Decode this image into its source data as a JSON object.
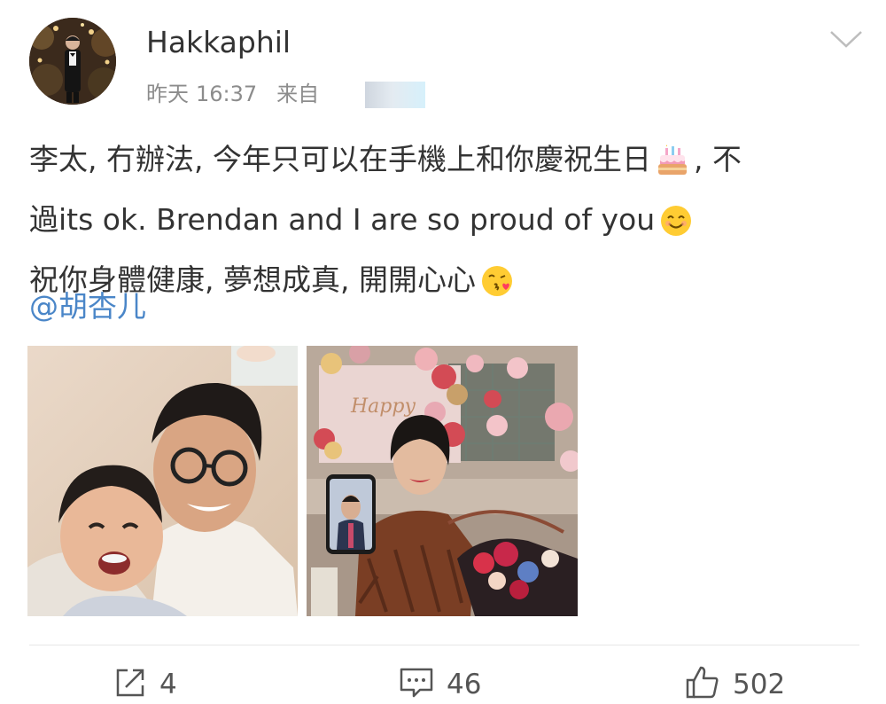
{
  "post": {
    "username": "Hakkaphil",
    "date": "昨天",
    "time": "16:37",
    "source": "来自",
    "lines": [
      {
        "text": "李太, 冇辦法, 今年只可以在手機上和你慶祝生日",
        "emoji": "birthday-cake",
        "tail": ", 不"
      },
      {
        "text": "過its ok. Brendan and I are so proud of you",
        "emoji": "smiling-face",
        "tail": ""
      },
      {
        "text": "祝你身體健康, 夢想成真, 開開心心",
        "emoji": "face-blowing-kiss",
        "tail": ""
      }
    ],
    "mention": "@胡杏儿"
  },
  "actions": {
    "repost_count": "4",
    "comment_count": "46",
    "like_count": "502"
  },
  "colors": {
    "mention": "#4a86c8",
    "meta": "#8c8c8c",
    "text": "#333333"
  },
  "icons": [
    "chevron-down-icon",
    "repost-icon",
    "comment-icon",
    "like-icon"
  ]
}
